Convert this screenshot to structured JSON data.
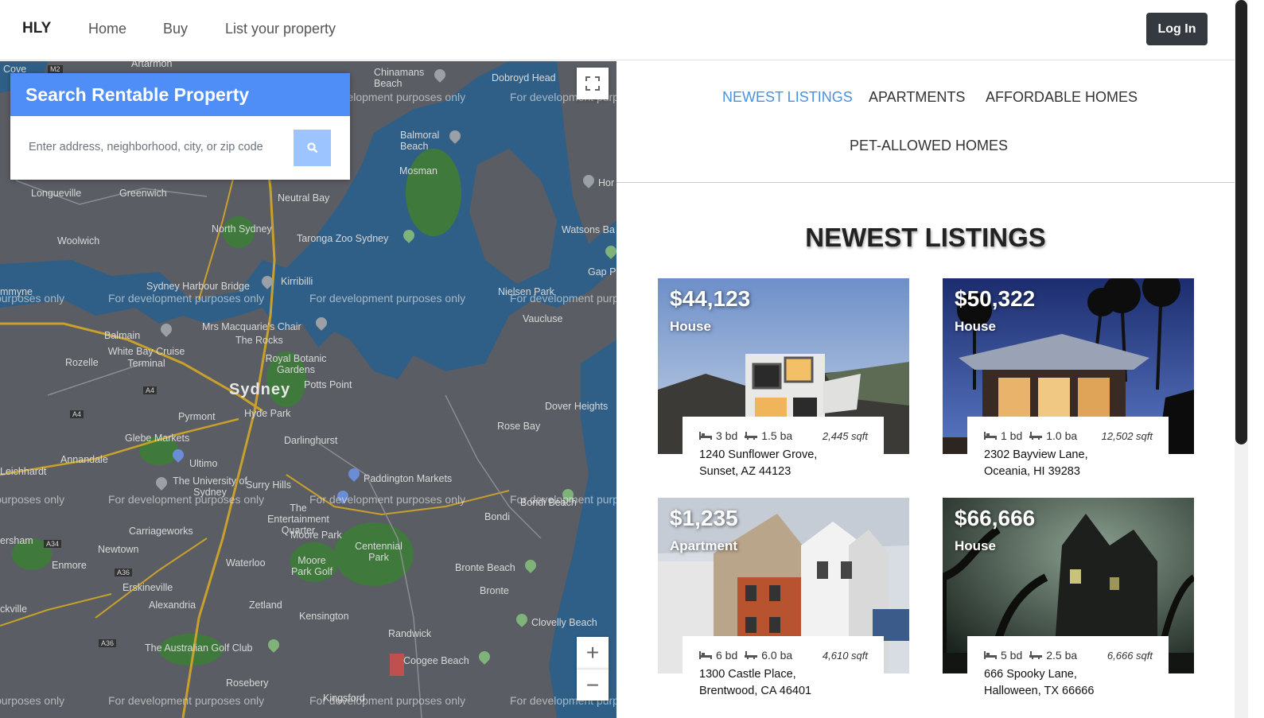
{
  "nav": {
    "brand": "HLY",
    "links": [
      "Home",
      "Buy",
      "List your property"
    ],
    "login_label": "Log In"
  },
  "search": {
    "title": "Search Rentable Property",
    "placeholder": "Enter address, neighborhood, city, or zip code",
    "button_icon": "search-icon"
  },
  "map": {
    "watermark": "For development purposes only",
    "labels": [
      "Cove",
      "Artarmon",
      "Chinamans Beach",
      "Dobroyd Head",
      "Balmoral Beach",
      "Mosman",
      "Longueville",
      "Greenwich",
      "Neutral Bay",
      "North Sydney",
      "Taronga Zoo Sydney",
      "Watsons Ba",
      "Woolwich",
      "Gap P",
      "Kirribilli",
      "Sydney Harbour Bridge",
      "Nielsen Park",
      "Vaucluse",
      "Mrs Macquarie's Chair",
      "The Rocks",
      "Balmain",
      "White Bay Cruise Terminal",
      "Rozelle",
      "Royal Botanic Gardens",
      "Potts Point",
      "Sydney",
      "Pyrmont",
      "Hyde Park",
      "Dover Heights",
      "Rose Bay",
      "Glebe Markets",
      "Darlinghurst",
      "Annandale",
      "Ultimo",
      "Leichhardt",
      "Paddington Markets",
      "The University of Sydney",
      "Surry Hills",
      "The Entertainment Quarter",
      "Bondi Beach",
      "Bondi",
      "Carriageworks",
      "Moore Park",
      "Centennial Park",
      "Newtown",
      "Enmore",
      "Waterloo",
      "Moore Park Golf",
      "Bronte Beach",
      "Erskineville",
      "Bronte",
      "Alexandria",
      "Zetland",
      "Kensington",
      "Clovelly Beach",
      "Randwick",
      "The Australian Golf Club",
      "Coogee Beach",
      "Rosebery",
      "Kingsford",
      "Hor",
      "Bronte",
      "ersham",
      "ckville",
      "mmyne"
    ],
    "road_shields": [
      "M2",
      "A4",
      "A4",
      "A34",
      "A36",
      "A36"
    ],
    "zoom_in": "+",
    "zoom_out": "−"
  },
  "tabs": [
    {
      "label": "NEWEST LISTINGS",
      "active": true
    },
    {
      "label": "APARTMENTS",
      "active": false
    },
    {
      "label": "AFFORDABLE HOMES",
      "active": false
    },
    {
      "label": "PET-ALLOWED HOMES",
      "active": false
    }
  ],
  "section_title": "NEWEST LISTINGS",
  "listings": [
    {
      "price": "$44,123",
      "type": "House",
      "beds": "3 bd",
      "baths": "1.5 ba",
      "sqft": "2,445 sqft",
      "address_line1": "1240 Sunflower Grove,",
      "address_line2": "Sunset, AZ 44123"
    },
    {
      "price": "$50,322",
      "type": "House",
      "beds": "1 bd",
      "baths": "1.0 ba",
      "sqft": "12,502 sqft",
      "address_line1": "2302 Bayview Lane,",
      "address_line2": "Oceania, HI 39283"
    },
    {
      "price": "$1,235",
      "type": "Apartment",
      "beds": "6 bd",
      "baths": "6.0 ba",
      "sqft": "4,610 sqft",
      "address_line1": "1300 Castle Place,",
      "address_line2": "Brentwood, CA 46401"
    },
    {
      "price": "$66,666",
      "type": "House",
      "beds": "5 bd",
      "baths": "2.5 ba",
      "sqft": "6,666 sqft",
      "address_line1": "666 Spooky Lane,",
      "address_line2": "Halloween, TX 66666"
    }
  ],
  "colors": {
    "accent": "#4f8ef7",
    "active_tab": "#4a90e2",
    "login_bg": "#343a40",
    "map_water": "#2f5f86",
    "map_land": "#5a5d63"
  }
}
